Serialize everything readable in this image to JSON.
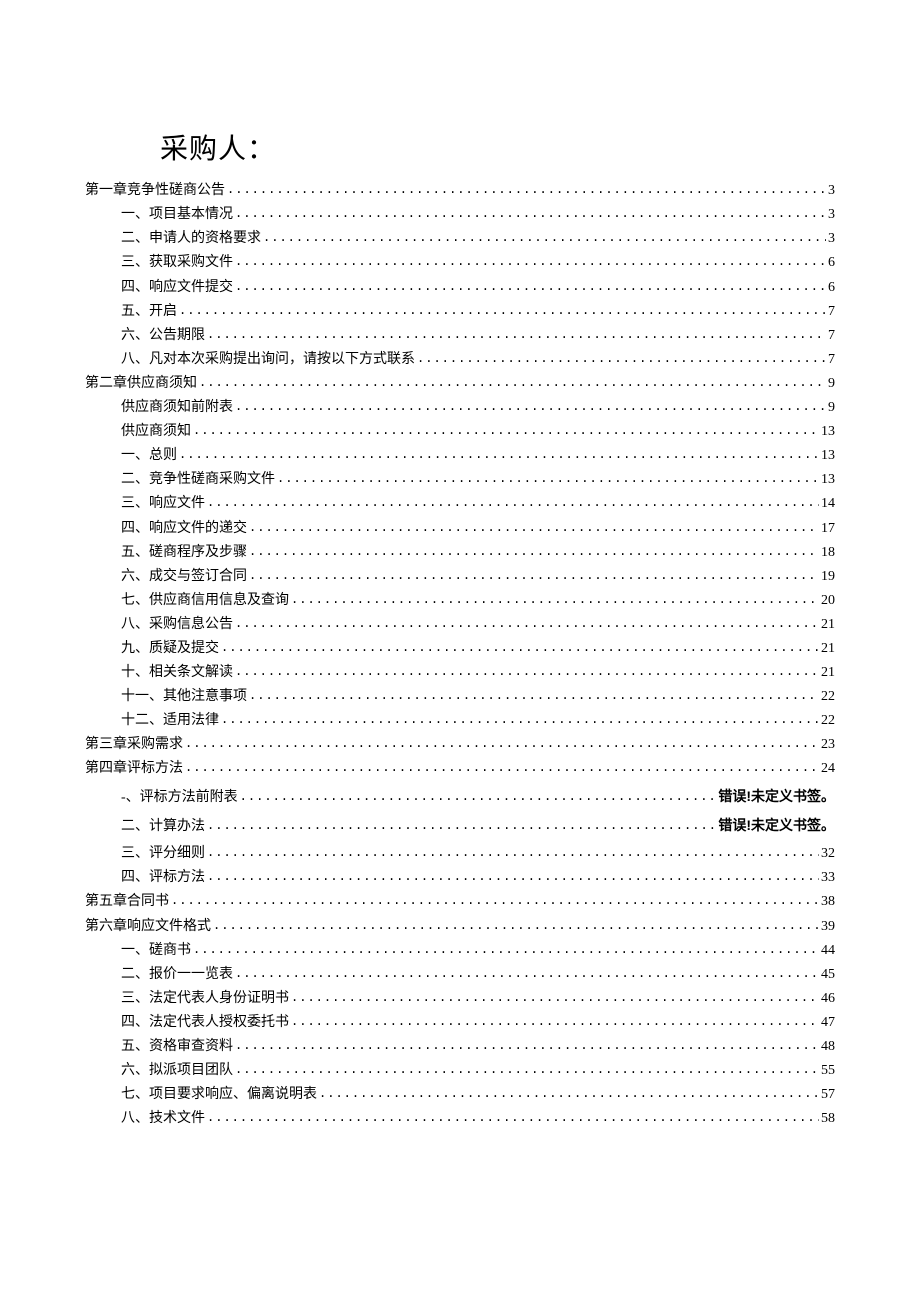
{
  "title": "采购人：",
  "toc": [
    {
      "text": "第一章竞争性磋商公告",
      "page": "3",
      "level": 0
    },
    {
      "text": "一、项目基本情况",
      "page": "3",
      "level": 1
    },
    {
      "text": "二、申请人的资格要求",
      "page": "3",
      "level": 1
    },
    {
      "text": "三、获取采购文件",
      "page": "6",
      "level": 1
    },
    {
      "text": "四、响应文件提交",
      "page": "6",
      "level": 1
    },
    {
      "text": "五、开启",
      "page": "7",
      "level": 1
    },
    {
      "text": "六、公告期限",
      "page": "7",
      "level": 1
    },
    {
      "text": "八、凡对本次采购提出询问，请按以下方式联系",
      "page": "7",
      "level": 1
    },
    {
      "text": "第二章供应商须知",
      "page": "9",
      "level": 0
    },
    {
      "text": "供应商须知前附表",
      "page": "9",
      "level": 1
    },
    {
      "text": "供应商须知",
      "page": "13",
      "level": 1
    },
    {
      "text": "一、总则",
      "page": "13",
      "level": 1
    },
    {
      "text": "二、竞争性磋商采购文件",
      "page": "13",
      "level": 1
    },
    {
      "text": "三、响应文件",
      "page": "14",
      "level": 1
    },
    {
      "text": "四、响应文件的递交",
      "page": "17",
      "level": 1
    },
    {
      "text": "五、磋商程序及步骤",
      "page": "18",
      "level": 1
    },
    {
      "text": "六、成交与签订合同",
      "page": "19",
      "level": 1
    },
    {
      "text": "七、供应商信用信息及查询",
      "page": "20",
      "level": 1
    },
    {
      "text": "八、采购信息公告",
      "page": "21",
      "level": 1
    },
    {
      "text": "九、质疑及提交",
      "page": "21",
      "level": 1
    },
    {
      "text": "十、相关条文解读",
      "page": "21",
      "level": 1
    },
    {
      "text": "十一、其他注意事项",
      "page": "22",
      "level": 1
    },
    {
      "text": "十二、适用法律",
      "page": "22",
      "level": 1
    },
    {
      "text": "第三章采购需求",
      "page": "23",
      "level": 0
    },
    {
      "text": "第四章评标方法",
      "page": "24",
      "level": 0
    },
    {
      "text": "-、评标方法前附表",
      "error": "错误!未定义书签。",
      "level": 1,
      "extraSpace": true
    },
    {
      "text": "二、计算办法",
      "error": "错误!未定义书签。",
      "level": 1,
      "extraSpace": true
    },
    {
      "text": "三、评分细则",
      "page": "32",
      "level": 1
    },
    {
      "text": "四、评标方法",
      "page": "33",
      "level": 1
    },
    {
      "text": "第五章合同书",
      "page": "38",
      "level": 0
    },
    {
      "text": "第六章响应文件格式",
      "page": "39",
      "level": 0
    },
    {
      "text": "一、磋商书",
      "page": "44",
      "level": 1
    },
    {
      "text": "二、报价一一览表",
      "page": "45",
      "level": 1
    },
    {
      "text": "三、法定代表人身份证明书",
      "page": "46",
      "level": 1
    },
    {
      "text": "四、法定代表人授权委托书",
      "page": "47",
      "level": 1
    },
    {
      "text": "五、资格审查资料",
      "page": "48",
      "level": 1
    },
    {
      "text": "六、拟派项目团队",
      "page": "55",
      "level": 1
    },
    {
      "text": "七、项目要求响应、偏离说明表",
      "page": "57",
      "level": 1
    },
    {
      "text": "八、技术文件",
      "page": "58",
      "level": 1
    }
  ]
}
